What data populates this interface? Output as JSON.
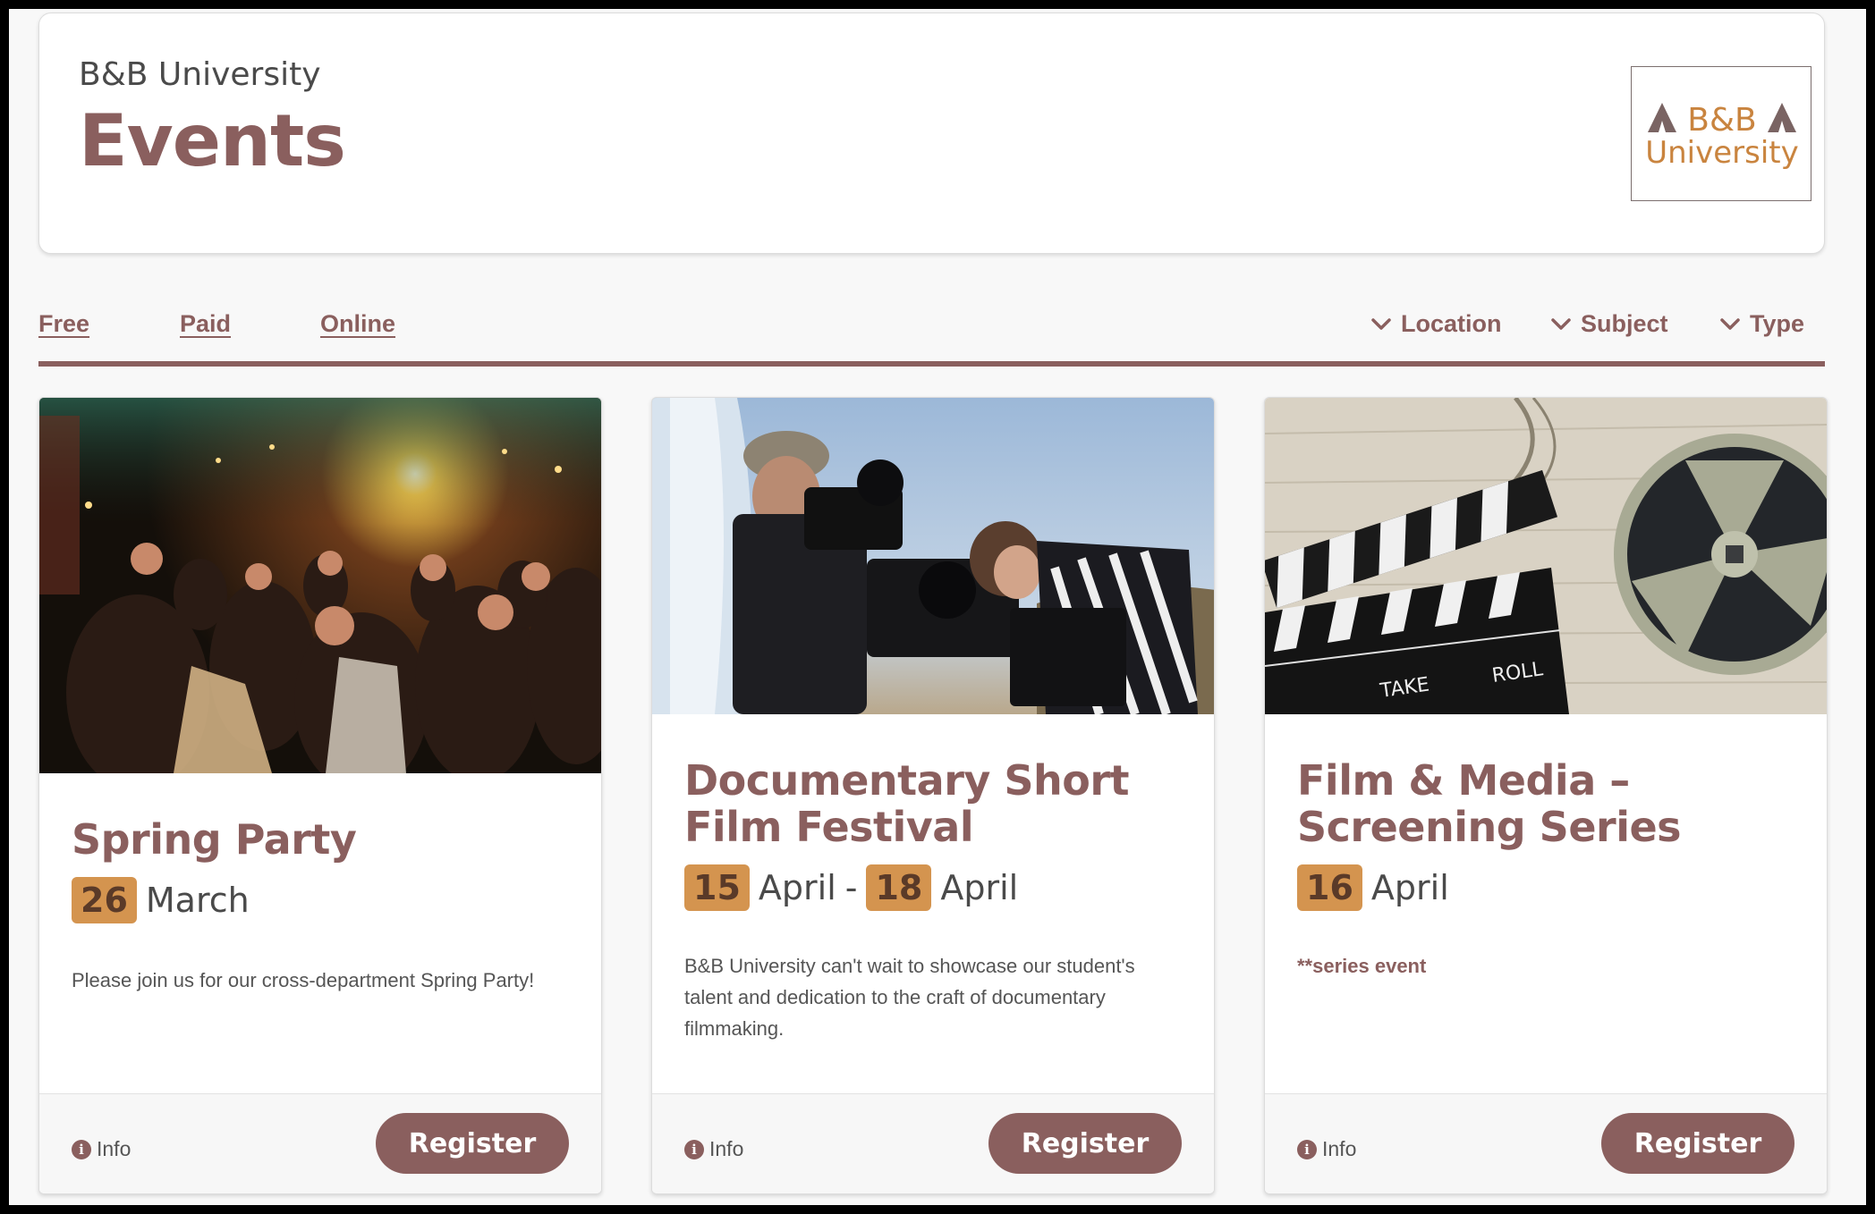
{
  "header": {
    "university": "B&B University",
    "title": "Events",
    "logo": {
      "line1": "B&B",
      "line2": "University"
    }
  },
  "filters": {
    "links": [
      "Free",
      "Paid",
      "Online"
    ],
    "dropdowns": [
      "Location",
      "Subject",
      "Type"
    ]
  },
  "events": [
    {
      "title": "Spring Party",
      "start_day": "26",
      "start_month": "March",
      "description": "Please join us for our cross-department Spring Party!",
      "info_label": "Info",
      "register_label": "Register"
    },
    {
      "title": "Documentary Short Film Festival",
      "start_day": "15",
      "start_month": "April",
      "separator": "-",
      "end_day": "18",
      "end_month": "April",
      "description": "B&B University can't wait to showcase our student's talent and dedication to the craft of documentary filmmaking.",
      "info_label": "Info",
      "register_label": "Register"
    },
    {
      "title": "Film & Media – Screening Series",
      "start_day": "16",
      "start_month": "April",
      "description": "**series event",
      "info_label": "Info",
      "register_label": "Register"
    }
  ],
  "colors": {
    "brand": "#8a5f5e",
    "badge": "#d4944f",
    "logo_text": "#c9843f"
  }
}
